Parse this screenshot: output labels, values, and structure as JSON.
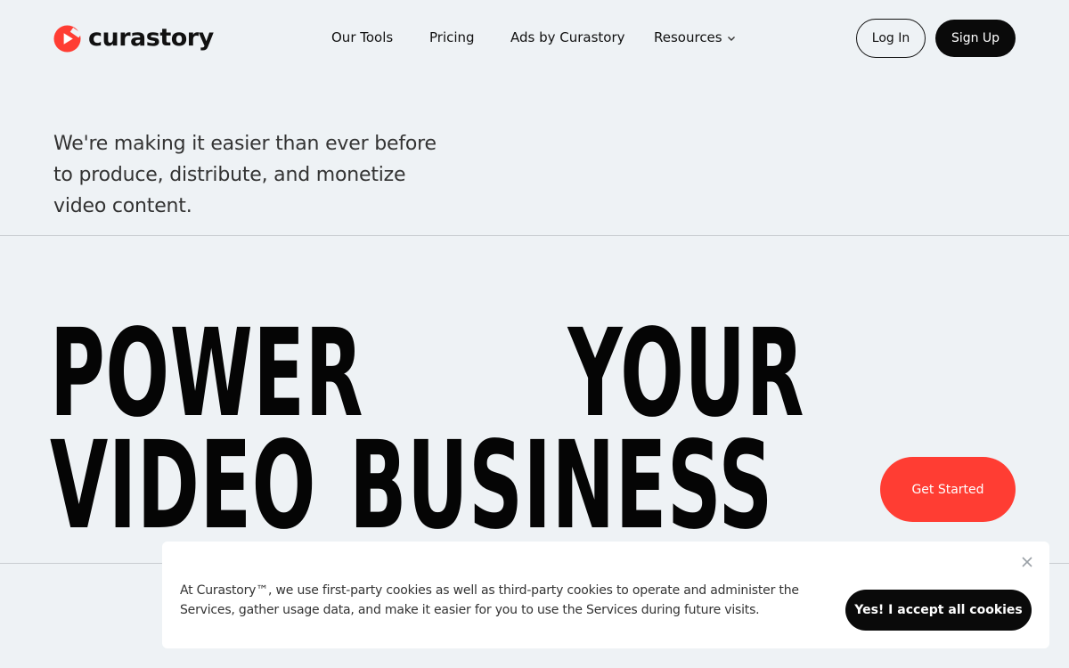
{
  "brand": {
    "name": "curastory",
    "accent_color": "#ff3d33"
  },
  "nav": {
    "items": [
      {
        "label": "Our Tools"
      },
      {
        "label": "Pricing"
      },
      {
        "label": "Ads by Curastory"
      },
      {
        "label": "Resources",
        "icon": "chevron-down-icon"
      }
    ],
    "login_label": "Log In",
    "signup_label": "Sign Up"
  },
  "hero": {
    "intro": "We're making it easier than ever before to produce, distribute, and monetize video content.",
    "headline_line1_word1": "POWER",
    "headline_line1_word2": "YOUR",
    "headline_line2_word1": "VIDEO",
    "headline_line2_word2": "BUSINESS",
    "cta_label": "Get Started"
  },
  "cookie_banner": {
    "text": "At Curastory™, we use first-party cookies as well as third-party cookies to operate and administer the Services, gather usage data, and make it easier for you to use the Services during future visits.",
    "accept_label": "Yes! I accept all cookies",
    "close_icon": "close-icon"
  }
}
